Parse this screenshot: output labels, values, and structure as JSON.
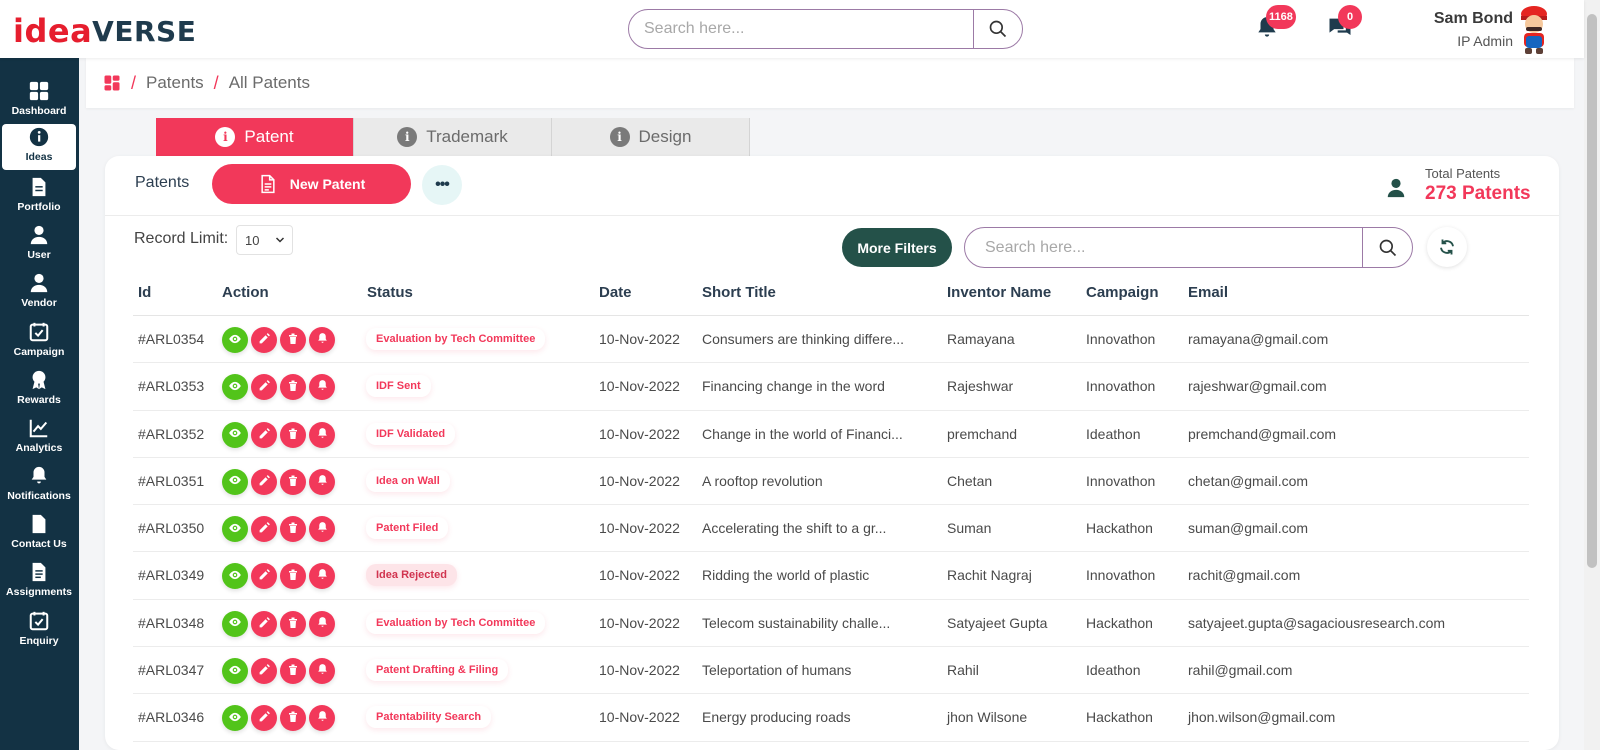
{
  "brand": {
    "part1": "idea",
    "part2": "VERSE",
    "red": "#e61e2e",
    "dark": "#1f3b4d"
  },
  "header": {
    "search_placeholder": "Search here...",
    "notifications_count": "1168",
    "messages_count": "0",
    "user_name": "Sam Bond",
    "user_role": "IP Admin"
  },
  "sidebar": {
    "items": [
      {
        "label": "Dashboard",
        "icon": "grid-icon"
      },
      {
        "label": "Ideas",
        "icon": "info-icon"
      },
      {
        "label": "Portfolio",
        "icon": "document-icon"
      },
      {
        "label": "User",
        "icon": "user-icon"
      },
      {
        "label": "Vendor",
        "icon": "user-icon"
      },
      {
        "label": "Campaign",
        "icon": "calendar-check-icon"
      },
      {
        "label": "Rewards",
        "icon": "award-icon"
      },
      {
        "label": "Analytics",
        "icon": "chart-line-icon"
      },
      {
        "label": "Notifications",
        "icon": "bell-icon"
      },
      {
        "label": "Contact Us",
        "icon": "file-icon"
      },
      {
        "label": "Assignments",
        "icon": "file-text-icon"
      },
      {
        "label": "Enquiry",
        "icon": "calendar-check-icon"
      }
    ],
    "active": "Ideas"
  },
  "breadcrumb": {
    "items": [
      "Patents",
      "All Patents"
    ]
  },
  "tabs": [
    {
      "label": "Patent",
      "active": true
    },
    {
      "label": "Trademark",
      "active": false
    },
    {
      "label": "Design",
      "active": false
    }
  ],
  "card": {
    "title": "Patents",
    "new_button": "New Patent",
    "more_label": "•••",
    "total_label": "Total Patents",
    "total_value": "273 Patents",
    "record_limit_label": "Record Limit:",
    "record_limit_value": "10",
    "filters_button": "More Filters",
    "search_placeholder": "Search here..."
  },
  "table": {
    "columns": [
      "Id",
      "Action",
      "Status",
      "Date",
      "Short Title",
      "Inventor Name",
      "Campaign",
      "Email"
    ],
    "rows": [
      {
        "id": "#ARL0354",
        "status": "Evaluation by Tech Committee",
        "date": "10-Nov-2022",
        "title": "Consumers are thinking differe...",
        "inventor": "Ramayana",
        "campaign": "Innovathon",
        "email": "ramayana@gmail.com"
      },
      {
        "id": "#ARL0353",
        "status": "IDF Sent",
        "date": "10-Nov-2022",
        "title": "Financing change in the word",
        "inventor": "Rajeshwar",
        "campaign": "Innovathon",
        "email": "rajeshwar@gmail.com"
      },
      {
        "id": "#ARL0352",
        "status": "IDF Validated",
        "date": "10-Nov-2022",
        "title": "Change in the world of Financi...",
        "inventor": "premchand",
        "campaign": "Ideathon",
        "email": "premchand@gmail.com"
      },
      {
        "id": "#ARL0351",
        "status": "Idea on Wall",
        "date": "10-Nov-2022",
        "title": "A rooftop revolution",
        "inventor": "Chetan",
        "campaign": "Innovathon",
        "email": "chetan@gmail.com"
      },
      {
        "id": "#ARL0350",
        "status": "Patent Filed",
        "date": "10-Nov-2022",
        "title": "Accelerating the shift to a gr...",
        "inventor": "Suman",
        "campaign": "Hackathon",
        "email": "suman@gmail.com"
      },
      {
        "id": "#ARL0349",
        "status": "Idea Rejected",
        "date": "10-Nov-2022",
        "title": "Ridding the world of plastic",
        "inventor": "Rachit Nagraj",
        "campaign": "Innovathon",
        "email": "rachit@gmail.com"
      },
      {
        "id": "#ARL0348",
        "status": "Evaluation by Tech Committee",
        "date": "10-Nov-2022",
        "title": "Telecom sustainability challe...",
        "inventor": "Satyajeet Gupta",
        "campaign": "Hackathon",
        "email": "satyajeet.gupta@sagaciousresearch.com"
      },
      {
        "id": "#ARL0347",
        "status": "Patent Drafting & Filing",
        "date": "10-Nov-2022",
        "title": "Teleportation of humans",
        "inventor": "Rahil",
        "campaign": "Ideathon",
        "email": "rahil@gmail.com"
      },
      {
        "id": "#ARL0346",
        "status": "Patentability Search",
        "date": "10-Nov-2022",
        "title": "Energy producing roads",
        "inventor": "jhon Wilsone",
        "campaign": "Hackathon",
        "email": "jhon.wilson@gmail.com"
      }
    ]
  },
  "colors": {
    "accent": "#f2385a",
    "sidebar": "#133244",
    "green": "#52c41a",
    "filters": "#245149"
  }
}
